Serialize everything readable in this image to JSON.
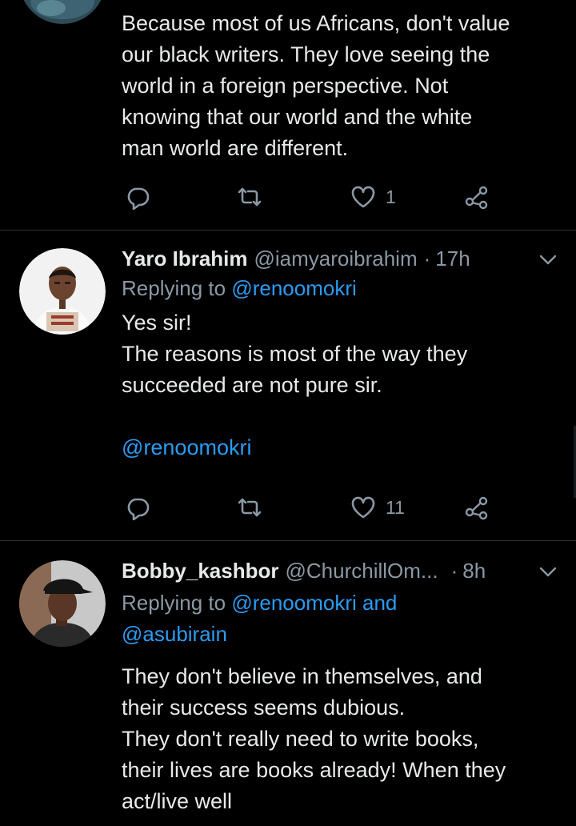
{
  "tweets": [
    {
      "body": [
        "Because most of us Africans, don't value",
        "our black writers. They love seeing the",
        "world in a foreign perspective. Not",
        "knowing that our world and the white",
        "man world are different."
      ],
      "actions": {
        "likes": "1"
      }
    },
    {
      "name": "Yaro Ibrahim",
      "handle": "@iamyaroibrahim",
      "dot": "·",
      "time": "17h",
      "reply_prefix": "Replying to",
      "reply_to": "@renoomokri",
      "body": [
        "Yes sir!",
        "The reasons is most of the way they",
        "succeeded are not pure sir."
      ],
      "mention_line": "@renoomokri",
      "actions": {
        "likes": "11"
      }
    },
    {
      "name": "Bobby_kashbor",
      "handle": "@ChurchillOm...",
      "dot": "·",
      "time": "8h",
      "reply_prefix": "Replying to",
      "reply_to_1": "@renoomokri",
      "reply_and": "and",
      "reply_to_2": "@asubirain",
      "body": [
        "They don't believe in themselves, and",
        "their success seems dubious.",
        "They don't really need to write books,",
        "their lives are books already! When they",
        "act/live well"
      ]
    }
  ],
  "icons": {
    "reply": "reply-icon",
    "retweet": "retweet-icon",
    "like": "heart-icon",
    "share": "share-icon",
    "more": "chevron-down-icon"
  },
  "colors": {
    "background": "#000000",
    "text": "#e7e9ea",
    "muted": "#8b98a5",
    "link": "#2b9bf0",
    "divider": "#2f3336"
  }
}
